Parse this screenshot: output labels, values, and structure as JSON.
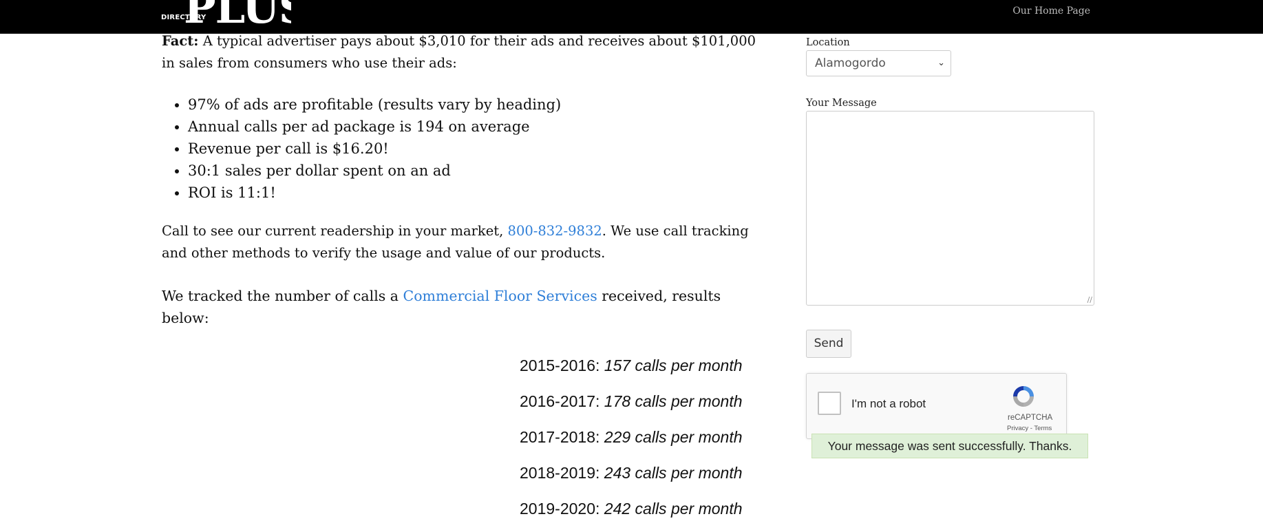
{
  "header": {
    "logo_small": "DIRECTORY",
    "logo_big": "PLUS",
    "home_link": "Our Home Page"
  },
  "content": {
    "fact_label": "Fact:",
    "fact_text": " A typical advertiser pays about $3,010 for their ads and receives about $101,000 in sales from consumers who use their ads:",
    "bullets": [
      "97% of ads are profitable (results vary by heading)",
      "Annual calls per ad package is 194 on average",
      "Revenue per call is $16.20!",
      "30:1 sales per dollar spent on an ad",
      "ROI is 11:1!"
    ],
    "call_text_before": "Call to see our current readership in your market, ",
    "phone": "800-832-9832",
    "call_text_after": ". We use call tracking and other methods to verify the usage and value of our products.",
    "tracked_before": "We tracked the number of calls a ",
    "tracked_link": "Commercial Floor Services",
    "tracked_after": " received, results below:",
    "stats": [
      {
        "period": "2015-2016: ",
        "value": "157 calls per month"
      },
      {
        "period": "2016-2017: ",
        "value": "178 calls per month"
      },
      {
        "period": "2017-2018: ",
        "value": "229 calls per month"
      },
      {
        "period": "2018-2019: ",
        "value": "243 calls per month"
      },
      {
        "period": "2019-2020: ",
        "value": "242 calls per month"
      }
    ]
  },
  "form": {
    "location_label": "Location",
    "location_value": "Alamogordo",
    "message_label": "Your Message",
    "send_label": "Send",
    "captcha_text": "I'm not a robot",
    "captcha_brand": "reCAPTCHA",
    "captcha_terms": "Privacy - Terms",
    "success_message": "Your message was sent successfully. Thanks."
  }
}
